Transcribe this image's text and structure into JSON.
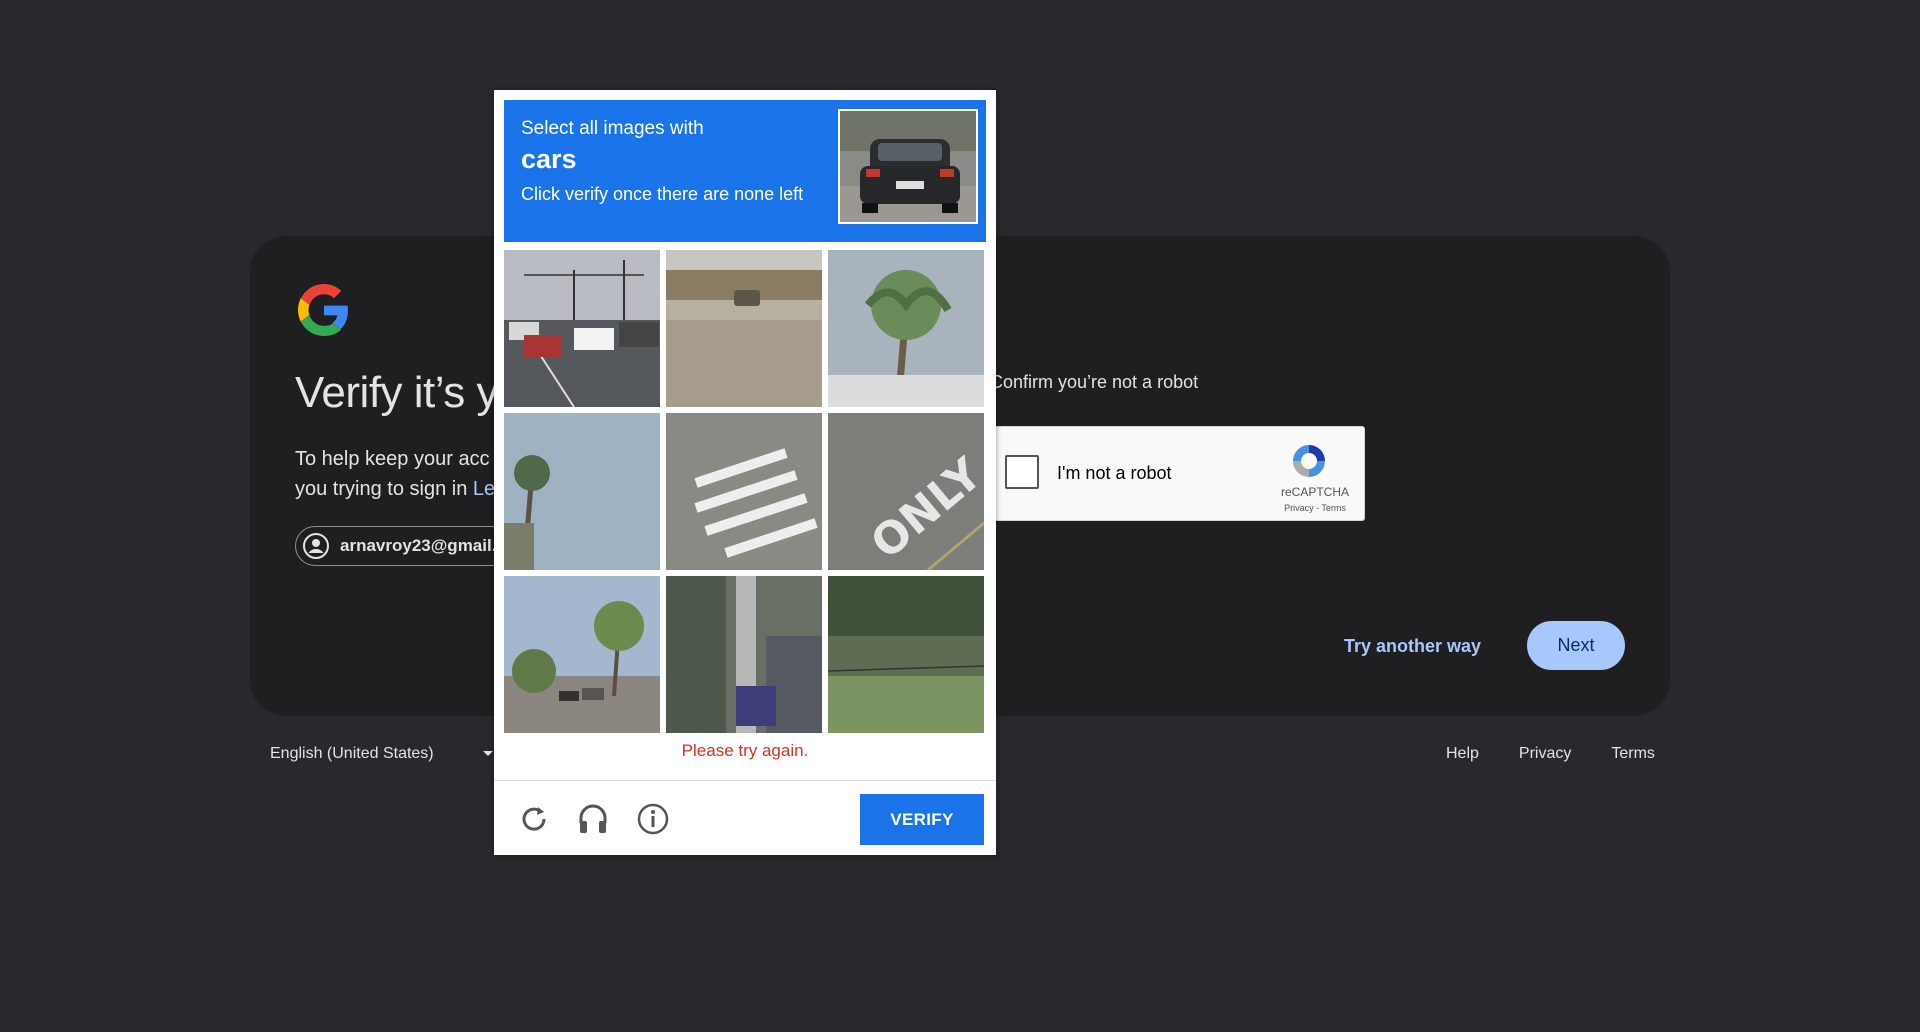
{
  "colors": {
    "page_bg": "#28292c",
    "card_bg": "#1f1f21",
    "challenge_header": "#1a73e8",
    "error_red": "#d93025",
    "link_blue": "#a8c7fa"
  },
  "card": {
    "title": "Verify it’s y",
    "subtitle_line1": "To help keep your acc",
    "subtitle_line2": "you trying to sign in",
    "subtitle_link": "Le",
    "account_email": "arnavroy23@gmail.",
    "confirm_text": "Confirm you’re not a robot",
    "recaptcha": {
      "label": "I'm not a robot",
      "brand": "reCAPTCHA",
      "links": "Privacy - Terms",
      "logo_icon": "recaptcha-logo-icon"
    },
    "try_another_way": "Try another way",
    "next": "Next"
  },
  "footer": {
    "language": "English (United States)",
    "links": [
      "Help",
      "Privacy",
      "Terms"
    ]
  },
  "challenge": {
    "line1": "Select all images with",
    "target": "cars",
    "line3": "Click verify once there are none left",
    "tiles": [
      "tile-intersection-cars",
      "tile-dirt-lot-car",
      "tile-palm-tree-sidewalk",
      "tile-palm-tree-sky",
      "tile-crosswalk",
      "tile-road-only-marking",
      "tile-street-palms-cars",
      "tile-pole-shadow",
      "tile-grass-hillside"
    ],
    "error": "Please try again.",
    "icons": [
      "reload-icon",
      "audio-icon",
      "info-icon"
    ],
    "verify": "VERIFY"
  }
}
